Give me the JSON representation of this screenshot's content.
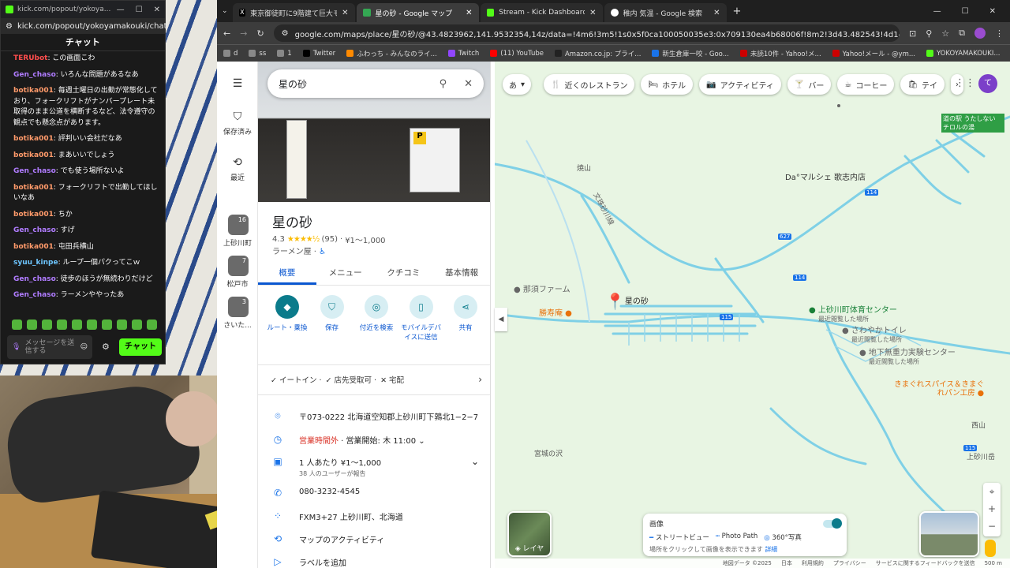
{
  "chat": {
    "window_title": "kick.com/popout/yokoya...",
    "url": "kick.com/popout/yokoyamakouki/chat",
    "header": "チャット",
    "messages": [
      {
        "user": "TERUbot",
        "text": "この画面こわ",
        "color": "#ff4d4d"
      },
      {
        "user": "Gen_chaso",
        "text": "いろんな問題があるなあ",
        "color": "#b07cff"
      },
      {
        "user": "botika001",
        "text": "毎週土曜日の出勤が常態化しており、フォークリフトがナンバープレート未取得のまま公道を横断するなど、法令遵守の観点でも懸念点があります。",
        "color": "#ff9a6a"
      },
      {
        "user": "botika001",
        "text": "評判いい会社だなあ",
        "color": "#ff9a6a"
      },
      {
        "user": "botika001",
        "text": "まあいいでしょう",
        "color": "#ff9a6a"
      },
      {
        "user": "Gen_chaso",
        "text": "でも使う場所ないよ",
        "color": "#b07cff"
      },
      {
        "user": "botika001",
        "text": "フォークリフトで出勤してほしいなあ",
        "color": "#ff9a6a"
      },
      {
        "user": "botika001",
        "text": "ちか",
        "color": "#ff9a6a"
      },
      {
        "user": "Gen_chaso",
        "text": "すげ",
        "color": "#b07cff"
      },
      {
        "user": "botika001",
        "text": "屯田兵横山",
        "color": "#ff9a6a"
      },
      {
        "user": "syuu_kinpe",
        "text": "ループ一個パクってこｗ",
        "color": "#6ec6ff"
      },
      {
        "user": "Gen_chaso",
        "text": "徒歩のほうが無続わりだけど",
        "color": "#b07cff"
      },
      {
        "user": "Gen_chaso",
        "text": "ラーメンややったあ",
        "color": "#b07cff"
      }
    ],
    "input_placeholder": "メッセージを送信する",
    "send_label": "チャット"
  },
  "browser": {
    "tabs": [
      {
        "title": "東京御徒町に9階建て巨大モスク計",
        "icon": "X",
        "active": false
      },
      {
        "title": "星の砂 - Google マップ",
        "icon": "maps",
        "active": true
      },
      {
        "title": "Stream - Kick Dashboard",
        "icon": "kick",
        "active": false
      },
      {
        "title": "稚内 気温 - Google 検索",
        "icon": "google",
        "active": false
      }
    ],
    "url": "google.com/maps/place/星の砂/@43.4823962,141.9532354,14z/data=!4m6!3m5!1s0x5f0ca100050035e3:0x709130ea4b68006f!8m2!3d43.482543!4d141.9531376!16s%2Fg%2Ff11...",
    "bookmarks": [
      "d",
      "ss",
      "1",
      "Twitter",
      "ふわっち - みんなのライ...",
      "Twitch",
      "(11) YouTube",
      "Amazon.co.jp: プライ...",
      "新生倉庫一咬 - Goo...",
      "未読10件 - Yahoo!メ...",
      "Yahoo!メール - @ym...",
      "YOKOYAMAKOUKI..."
    ]
  },
  "maps": {
    "rail": {
      "menu": "☰",
      "saved": "保存済み",
      "recent": "最近",
      "recents": [
        {
          "name": "上砂川町",
          "badge": "16"
        },
        {
          "name": "松戸市",
          "badge": "7"
        },
        {
          "name": "さいた...",
          "badge": "3"
        }
      ]
    },
    "search_value": "星の砂",
    "place": {
      "name": "星の砂",
      "rating": "4.3",
      "stars": "★★★★½",
      "reviews": "(95)",
      "price": "¥1～1,000",
      "category": "ラーメン屋 ·"
    },
    "tabs": [
      "概要",
      "メニュー",
      "クチコミ",
      "基本情報"
    ],
    "actions": [
      {
        "label": "ルート・乗換",
        "icon": "◆"
      },
      {
        "label": "保存",
        "icon": "⛉"
      },
      {
        "label": "付近を検索",
        "icon": "◎"
      },
      {
        "label": "モバイルデバイスに送信",
        "icon": "▯"
      },
      {
        "label": "共有",
        "icon": "⋖"
      }
    ],
    "dine": [
      "✓ イートイン ·",
      "✓ 店先受取可 ·",
      "✕ 宅配"
    ],
    "info": {
      "address": "〒073-0222 北海道空知郡上砂川町下鶉北1−2−7",
      "hours_status": "営業時間外",
      "hours_next": " · 営業開始: 木 11:00",
      "price": "1 人あたり ¥1～1,000",
      "price_sub": "38 人のユーザーが報告",
      "phone": "080-3232-4545",
      "pluscode": "FXM3+27 上砂川町、北海道",
      "activity": "マップのアクティビティ",
      "label": "ラベルを追加"
    },
    "chips": [
      "近くのレストラン",
      "ホテル",
      "アクティビティ",
      "バー",
      "コーヒー",
      "テイ"
    ],
    "lang": "あ",
    "avatar": "て",
    "labels": {
      "marker": "星の砂",
      "farm": "那須ファーム",
      "katsujuan": "勝寿庵",
      "gym": "上砂川町体育センター",
      "gym_sub": "最近閲覧した場所",
      "toilet": "さわやかトイレ",
      "toilet_sub": "最近閲覧した場所",
      "lab": "地下無重力実験センター",
      "lab_sub": "最近閲覧した場所",
      "spice": "きまぐれスパイス＆きまぐれパン工房",
      "marche": "Da°マルシェ 歌志内店",
      "michi": "道の駅 うたしない チロルの湯",
      "miyagi": "宮城の沢",
      "kamisuna": "上砂川岳",
      "yama": "焼山",
      "nishiyama": "西山",
      "road_kawa": "文珠砂川線",
      "r114": "114",
      "r627": "627",
      "r115": "115"
    },
    "imagery": {
      "title": "画像",
      "street": "ストリートビュー",
      "photo": "Photo Path",
      "p360": "360°写真",
      "hint": "場所をクリックして画像を表示できます",
      "more": "詳細"
    },
    "layer_label": "レイヤ",
    "footer": [
      "地図データ ©2025",
      "日本",
      "利用規約",
      "プライバシー",
      "サービスに関するフィードバックを送信",
      "500 m"
    ]
  }
}
